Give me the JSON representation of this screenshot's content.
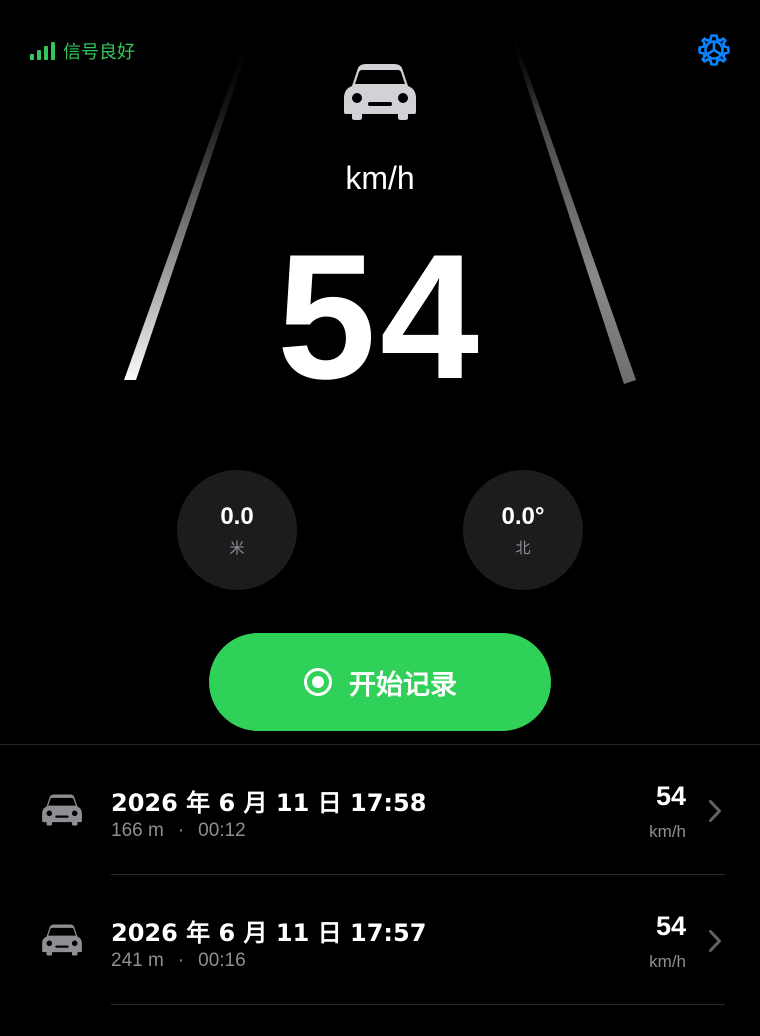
{
  "status": {
    "signal_text": "信号良好",
    "signal_color": "#34c759"
  },
  "settings": {
    "icon": "gear-icon",
    "color": "#0a84ff"
  },
  "speedometer": {
    "unit": "km/h",
    "speed": "54",
    "icon": "car-icon"
  },
  "gauges": {
    "altitude": {
      "value": "0.0",
      "label": "米"
    },
    "heading": {
      "value": "0.0°",
      "label": "北",
      "marker_color": "#ff3b30"
    }
  },
  "record_button": {
    "label": "开始记录",
    "icon": "record-icon",
    "color": "#30d158"
  },
  "trips": [
    {
      "title": "2026 年 6 月 11 日 17:58",
      "distance": "166 m",
      "separator": "·",
      "duration": "00:12",
      "speed": "54",
      "unit": "km/h"
    },
    {
      "title": "2026 年 6 月 11 日 17:57",
      "distance": "241 m",
      "separator": "·",
      "duration": "00:16",
      "speed": "54",
      "unit": "km/h"
    }
  ]
}
